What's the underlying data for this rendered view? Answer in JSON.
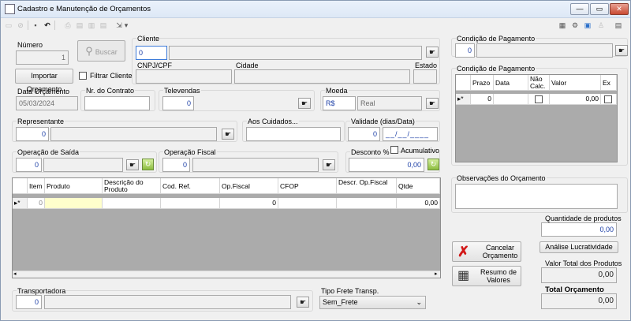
{
  "window": {
    "title": "Cadastro e Manutenção de Orçamentos",
    "minimize": "—",
    "maximize": "▭",
    "close": "✕"
  },
  "toolbar": {
    "new": "▭",
    "cancel": "⊘",
    "save": "▪",
    "undo": "↶",
    "print": "⎙",
    "preview": "▤",
    "copy": "▥",
    "export": "⇲",
    "dropdown": "▾",
    "r1": "▦",
    "r2": "⚙",
    "r3": "▣",
    "r4": "♙",
    "r5": "▤"
  },
  "numero": {
    "label": "Número",
    "value": "1",
    "buscar": "Buscar"
  },
  "cliente": {
    "label": "Cliente",
    "code": "0",
    "cnpj_label": "CNPJ/CPF",
    "cidade_label": "Cidade",
    "estado_label": "Estado"
  },
  "importar": {
    "label": "Importar Orçamento"
  },
  "filtrar": {
    "label": "Filtrar Cliente"
  },
  "data_orcamento": {
    "label": "Data Orçamento",
    "value": "05/03/2024"
  },
  "contrato": {
    "label": "Nr. do Contrato",
    "value": ""
  },
  "televendas": {
    "label": "Televendas",
    "value": "0"
  },
  "moeda": {
    "label": "Moeda",
    "code": "R$",
    "name": "Real"
  },
  "representante": {
    "label": "Representante",
    "value": "0"
  },
  "aos_cuidados": {
    "label": "Aos Cuidados...",
    "value": ""
  },
  "validade": {
    "label": "Validade (dias/Data)",
    "days": "0",
    "date": "__/__/____"
  },
  "operacao_saida": {
    "label": "Operação de Saída",
    "value": "0"
  },
  "operacao_fiscal": {
    "label": "Operação Fiscal",
    "value": "0"
  },
  "desconto": {
    "label": "Desconto %",
    "value": "0,00",
    "cumulativo": "Acumulativo"
  },
  "items_grid": {
    "headers": [
      "Item",
      "Produto",
      "Descrição do Produto",
      "Cod. Ref.",
      "Op.Fiscal",
      "CFOP",
      "Descr. Op.Fiscal",
      "Qtde"
    ],
    "row": {
      "indicator": "▸*",
      "item": "0",
      "produto": "",
      "descricao": "",
      "cod_ref": "",
      "op_fiscal": "0",
      "cfop": "",
      "descr_op": "",
      "qtde": "0,00"
    }
  },
  "transportadora": {
    "label": "Transportadora",
    "value": "0"
  },
  "tipo_frete": {
    "label": "Tipo Frete Transp.",
    "value": "Sem_Frete"
  },
  "condicao_pagamento": {
    "label": "Condição de Pagamento",
    "value": "0"
  },
  "condicao_grid": {
    "label": "Condição de Pagamento",
    "headers": [
      "Prazo",
      "Data",
      "Não Calc.",
      "Valor",
      "Ex"
    ],
    "row": {
      "indicator": "▸*",
      "prazo": "0",
      "data": "",
      "valor": "0,00"
    }
  },
  "observacoes": {
    "label": "Observações do Orçamento",
    "value": ""
  },
  "cancelar": {
    "label": "Cancelar Orçamento",
    "icon": "✗"
  },
  "resumo": {
    "label": "Resumo de Valores",
    "icon": "▦"
  },
  "quantidade_produtos": {
    "label": "Quantidade de produtos",
    "value": "0,00"
  },
  "analise": {
    "label": "Análise Lucratividade"
  },
  "valor_total_produtos": {
    "label": "Valor Total dos Produtos",
    "value": "0,00"
  },
  "total_orcamento": {
    "label": "Total Orçamento",
    "value": "0,00"
  },
  "icons": {
    "lookup": "☛",
    "refresh": "↻",
    "search": "⚲",
    "chevron": "⌄"
  }
}
